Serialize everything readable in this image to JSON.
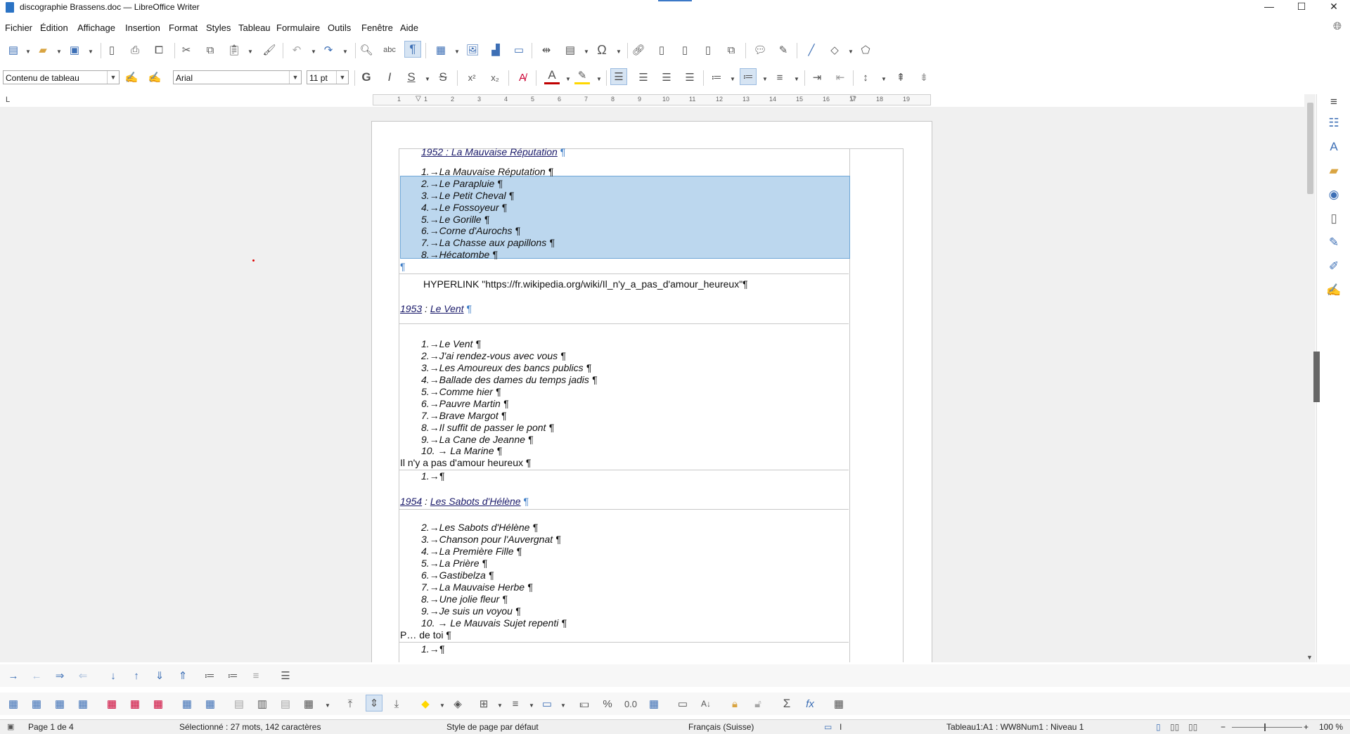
{
  "window": {
    "title": "discographie Brassens.doc — LibreOffice Writer",
    "minimize": "—",
    "maximize": "☐",
    "close": "✕"
  },
  "menu": [
    "Fichier",
    "Édition",
    "Affichage",
    "Insertion",
    "Format",
    "Styles",
    "Tableau",
    "Formulaire",
    "Outils",
    "Fenêtre",
    "Aide"
  ],
  "format_bar": {
    "paragraph_style": "Contenu de tableau",
    "font_name": "Arial",
    "font_size": "11 pt",
    "bold_label": "G",
    "italic_label": "I",
    "underline_label": "S",
    "strike_label": "S"
  },
  "ruler": {
    "numbers": [
      "1",
      "1",
      "2",
      "3",
      "4",
      "5",
      "6",
      "7",
      "8",
      "9",
      "10",
      "11",
      "12",
      "13",
      "14",
      "15",
      "16",
      "17",
      "18",
      "19"
    ]
  },
  "document": {
    "album1_heading": "1952 : La Mauvaise Réputation",
    "album1_tracks": [
      "1.→La Mauvaise Réputation ¶",
      "2.→Le Parapluie ¶",
      "3.→Le Petit Cheval ¶",
      "4.→Le Fossoyeur ¶",
      "5.→Le Gorille ¶",
      "6.→Corne d'Aurochs ¶",
      "7.→La Chasse aux papillons ¶",
      "8.→Hécatombe ¶"
    ],
    "empty_para": "¶",
    "hyperlink_field": "HYPERLINK \"https://fr.wikipedia.org/wiki/Il_n'y_a_pas_d'amour_heureux\"¶",
    "album2_year": "1953",
    "album2_sep": " : ",
    "album2_title": "Le Vent",
    "album2_tracks": [
      "1.→Le Vent ¶",
      "2.→J'ai rendez-vous avec vous ¶",
      "3.→Les Amoureux des bancs publics ¶",
      "4.→Ballade des dames du temps jadis ¶",
      "5.→Comme hier ¶",
      "6.→Pauvre Martin ¶",
      "7.→Brave Margot ¶",
      "8.→Il suffit de passer le pont ¶",
      "9.→La Cane de Jeanne ¶",
      "10.     →     La Marine ¶"
    ],
    "il_ny_a_pas": "Il n'y a pas d'amour heureux ¶",
    "empty_item_1": "1.→¶",
    "album3_year": "1954",
    "album3_sep": " : ",
    "album3_title": "Les Sabots d'Hélène",
    "album3_tracks": [
      "2.→Les Sabots d'Hélène ¶",
      "3.→Chanson pour l'Auvergnat ¶",
      "4.→La Première Fille ¶",
      "5.→La Prière ¶",
      "6.→Gastibelza ¶",
      "7.→La Mauvaise Herbe ¶",
      "8.→Une jolie fleur ¶",
      "9.→Je suis un voyou ¶",
      "10.     →     Le Mauvais Sujet repenti ¶"
    ],
    "p_de_toi": "P… de toi ¶",
    "empty_item_2": "1.→¶"
  },
  "status": {
    "page": "Page 1 de 4",
    "selection": "Sélectionné : 27 mots, 142 caractères",
    "page_style": "Style de page par défaut",
    "language": "Français (Suisse)",
    "table_info": "Tableau1:A1 : WW8Num1 : Niveau 1",
    "zoom": "100 %"
  },
  "colors": {
    "accent": "#3d6fb5",
    "selection": "#bcd7ee",
    "font_color": "#c00000",
    "highlight": "#ffd700"
  }
}
